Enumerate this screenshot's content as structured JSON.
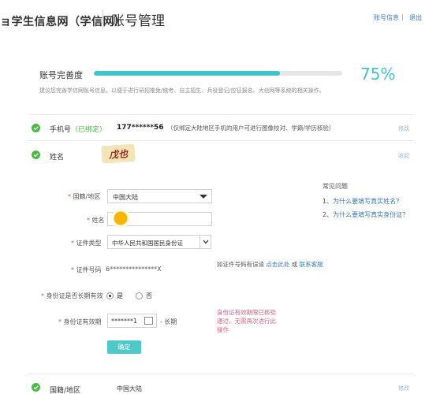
{
  "header": {
    "site_title": "ョ学生信息网（学信网）",
    "page_title": "账号管理",
    "account_info_link": "账号信息",
    "separator": "|",
    "logout_link": "退出"
  },
  "completeness": {
    "label": "账号完善度",
    "percent_text": "75%",
    "progress": 0.75,
    "hint": "建议您完善学信网账号信息，以便于进行研招推免/统考、自主招生、兵役登记/应征报名、大创网等系统的相关操作。"
  },
  "phone_row": {
    "label": "手机号",
    "bound_badge": "（已绑定）",
    "value": "177******56",
    "note": "（仅绑定大陆地区手机的用户可进行图像校对、学籍/学历核验）",
    "action": "修改"
  },
  "name_row": {
    "label": "姓名",
    "stamp_text": "戊也",
    "action": "收起"
  },
  "form": {
    "country_label": "国籍/地区",
    "country_value": "中国大陆",
    "name_label": "姓名",
    "id_type_label": "证件类型",
    "id_type_value": "中华人民共和国居民身份证",
    "id_number_label": "证件号码",
    "id_number_value": "6***************X",
    "id_hint_prefix": "如证件号码有误请",
    "id_hint_link1": "点击此处",
    "id_hint_or": "或",
    "id_hint_link2": "联系客服",
    "long_term_label": "身份证是否长期有效",
    "radio_yes": "是",
    "radio_no": "否",
    "expiry_label": "身份证有效期",
    "expiry_value": "*******1",
    "long_term_text": "- 长期",
    "expiry_warning": "身份证有效期限已核验通过，无需再次进行此操作",
    "confirm_button": "确定"
  },
  "faq": {
    "title": "常见问题",
    "items": [
      {
        "num": "1、",
        "text": "为什么要填写真实姓名？"
      },
      {
        "num": "2、",
        "text": "为什么要填写真实身份证？"
      }
    ]
  },
  "region_row": {
    "label": "国籍/地区",
    "value": "中国大陆",
    "action": "修改"
  },
  "colors": {
    "accent": "#3fc4c7",
    "verified": "#4db848",
    "link": "#3b7bbf",
    "warning": "#e0607a"
  }
}
